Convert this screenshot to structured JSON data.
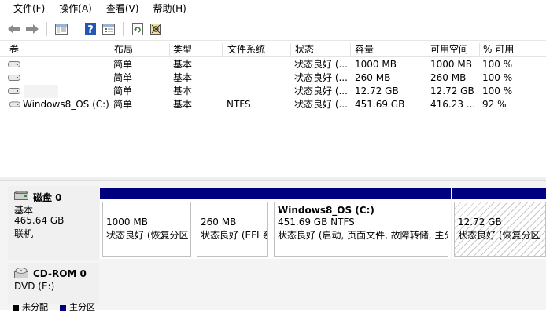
{
  "menu": [
    "文件(F)",
    "操作(A)",
    "查看(V)",
    "帮助(H)"
  ],
  "toolbar": {
    "buttons": [
      "back-arrow-icon",
      "forward-arrow-icon",
      "console-tree-icon",
      "help-icon",
      "properties-icon",
      "refresh-icon",
      "settings-icon"
    ]
  },
  "columns": [
    "卷",
    "布局",
    "类型",
    "文件系统",
    "状态",
    "容量",
    "可用空间",
    "% 可用"
  ],
  "volumes": [
    {
      "name": "",
      "layout": "简单",
      "type": "基本",
      "fs": "",
      "status": "状态良好 (...",
      "capacity": "1000 MB",
      "free": "1000 MB",
      "pct": "100 %"
    },
    {
      "name": "",
      "layout": "简单",
      "type": "基本",
      "fs": "",
      "status": "状态良好 (...",
      "capacity": "260 MB",
      "free": "260 MB",
      "pct": "100 %"
    },
    {
      "name": "",
      "layout": "简单",
      "type": "基本",
      "fs": "",
      "status": "状态良好 (...",
      "capacity": "12.72 GB",
      "free": "12.72 GB",
      "pct": "100 %"
    },
    {
      "name": "Windows8_OS (C:)",
      "layout": "简单",
      "type": "基本",
      "fs": "NTFS",
      "status": "状态良好 (...",
      "capacity": "451.69 GB",
      "free": "416.23 ...",
      "pct": "92 %"
    }
  ],
  "disk0": {
    "title": "磁盘 0",
    "type": "基本",
    "size": "465.64 GB",
    "state": "联机",
    "partitions": [
      {
        "name": "",
        "size": "1000 MB",
        "status": "状态良好 (恢复分区"
      },
      {
        "name": "",
        "size": "260 MB",
        "status": "状态良好 (EFI 系"
      },
      {
        "name": "Windows8_OS  (C:)",
        "size": "451.69 GB NTFS",
        "status": "状态良好 (启动, 页面文件, 故障转储, 主分"
      },
      {
        "name": "",
        "size": "12.72 GB",
        "status": "状态良好 (恢复分区"
      }
    ]
  },
  "cdrom0": {
    "title": "CD-ROM 0",
    "drive": "DVD (E:)"
  },
  "legend": [
    "未分配",
    "主分区"
  ],
  "colors": {
    "partition_bar": "#00007f",
    "legend_unallocated": "#000000",
    "legend_primary": "#00007f"
  }
}
